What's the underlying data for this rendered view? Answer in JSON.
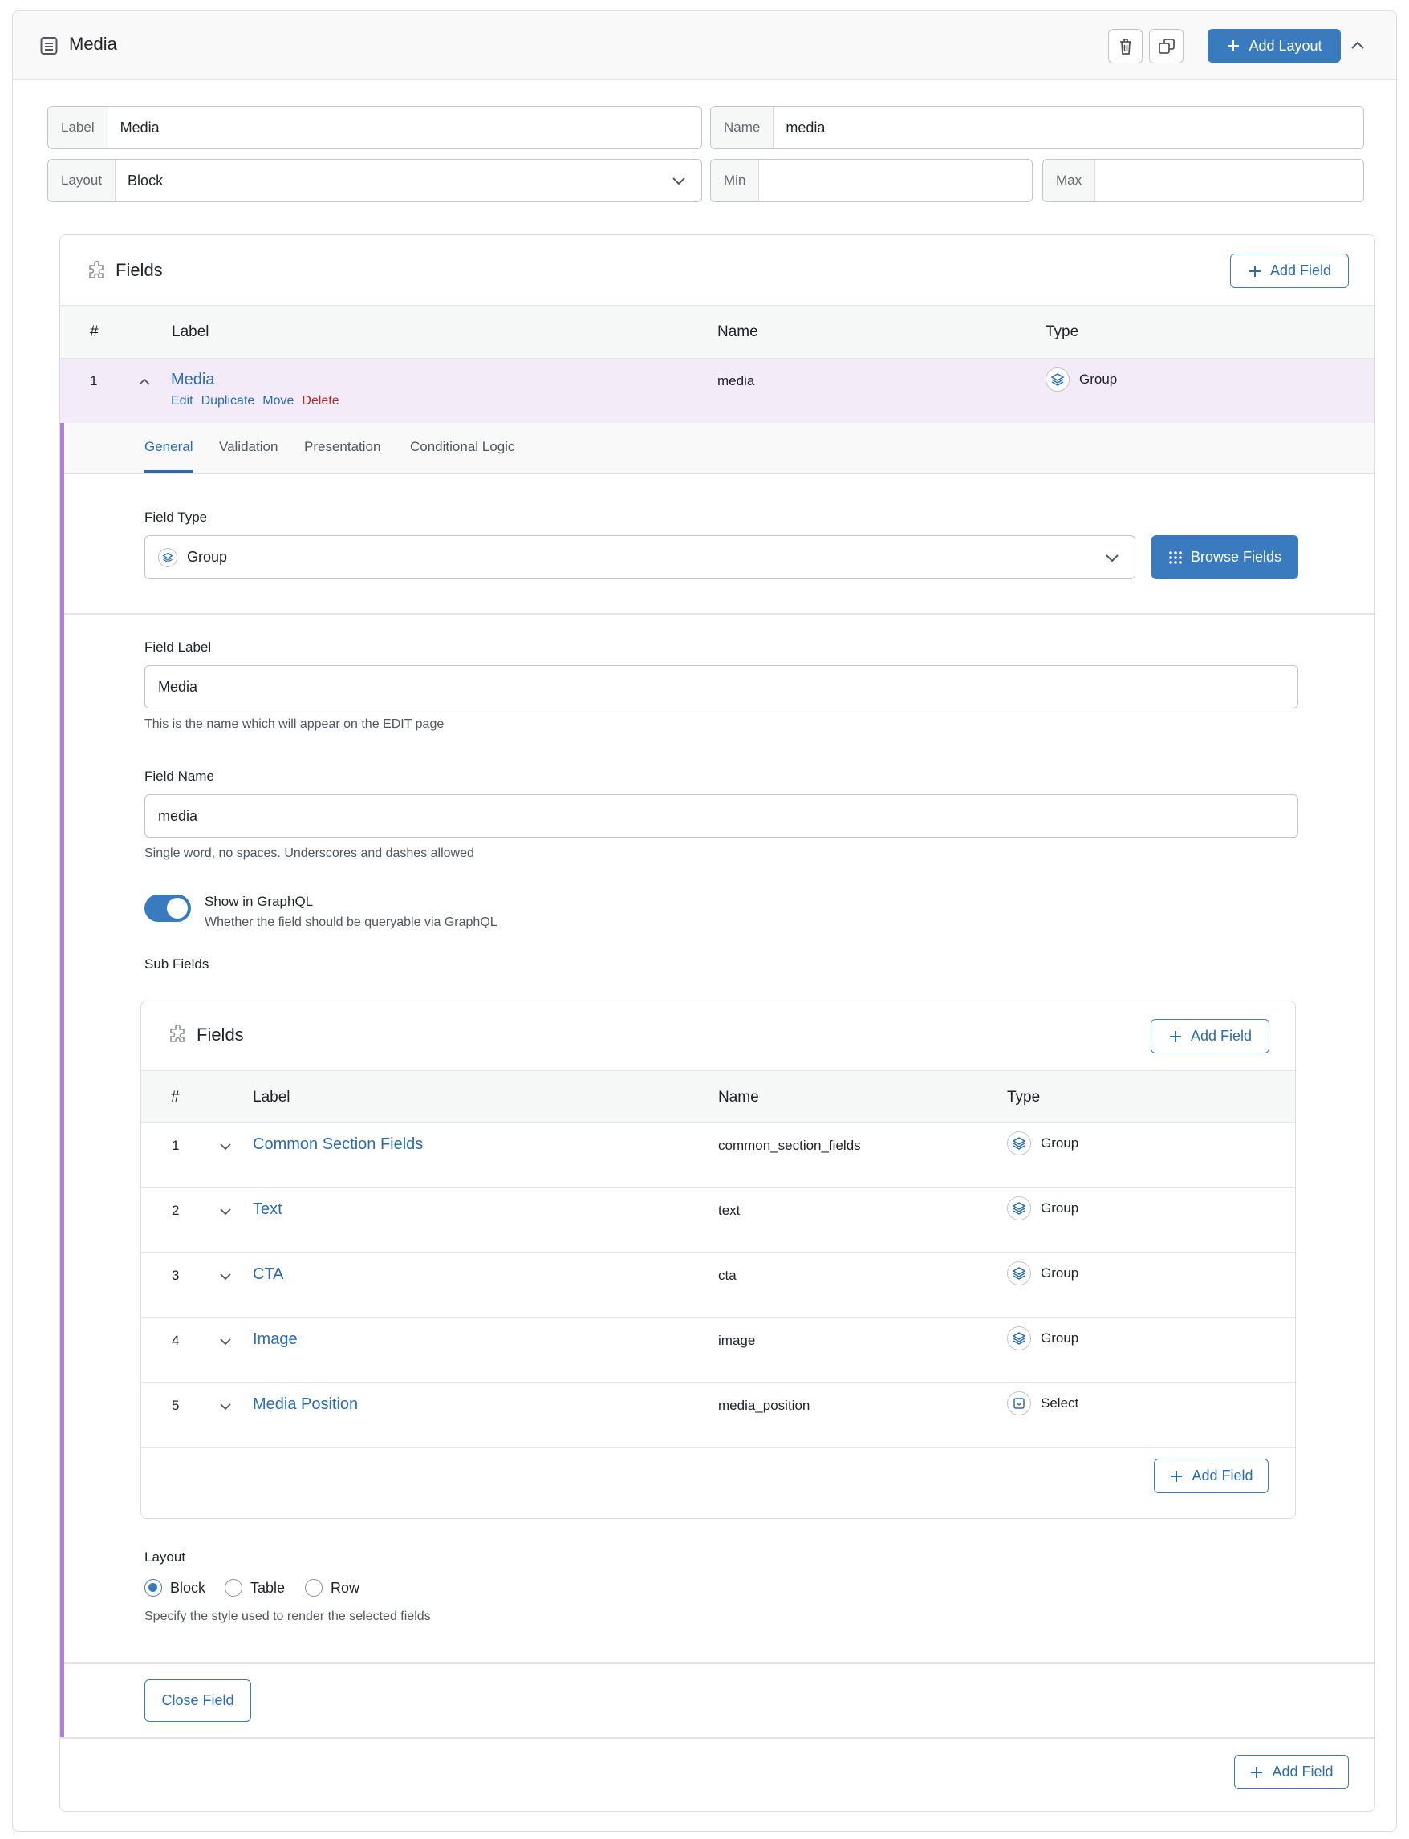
{
  "layout": {
    "title": "Media",
    "add_layout_label": "Add Layout",
    "label_prefix": "Label",
    "label_value": "Media",
    "name_prefix": "Name",
    "name_value": "media",
    "layout_prefix": "Layout",
    "layout_value": "Block",
    "min_prefix": "Min",
    "min_value": "",
    "max_prefix": "Max",
    "max_value": ""
  },
  "fields": {
    "title": "Fields",
    "add_field_label": "Add Field",
    "columns": {
      "num": "#",
      "label": "Label",
      "name": "Name",
      "type": "Type"
    },
    "row": {
      "num": "1",
      "label": "Media",
      "name": "media",
      "type": "Group",
      "actions": {
        "edit": "Edit",
        "duplicate": "Duplicate",
        "move": "Move",
        "delete": "Delete"
      }
    }
  },
  "tabs": [
    "General",
    "Validation",
    "Presentation",
    "Conditional Logic"
  ],
  "field_type": {
    "label": "Field Type",
    "value": "Group",
    "browse_label": "Browse Fields"
  },
  "field_label": {
    "label": "Field Label",
    "value": "Media",
    "hint": "This is the name which will appear on the EDIT page"
  },
  "field_name": {
    "label": "Field Name",
    "value": "media",
    "hint": "Single word, no spaces. Underscores and dashes allowed"
  },
  "graphql": {
    "label": "Show in GraphQL",
    "hint": "Whether the field should be queryable via GraphQL",
    "enabled": true
  },
  "sub_fields": {
    "label": "Sub Fields",
    "title": "Fields",
    "add_field_label": "Add Field",
    "columns": {
      "num": "#",
      "label": "Label",
      "name": "Name",
      "type": "Type"
    },
    "rows": [
      {
        "num": "1",
        "label": "Common Section Fields",
        "name": "common_section_fields",
        "type": "Group",
        "icon": "layers-icon"
      },
      {
        "num": "2",
        "label": "Text",
        "name": "text",
        "type": "Group",
        "icon": "layers-icon"
      },
      {
        "num": "3",
        "label": "CTA",
        "name": "cta",
        "type": "Group",
        "icon": "layers-icon"
      },
      {
        "num": "4",
        "label": "Image",
        "name": "image",
        "type": "Group",
        "icon": "layers-icon"
      },
      {
        "num": "5",
        "label": "Media Position",
        "name": "media_position",
        "type": "Select",
        "icon": "select-icon"
      }
    ]
  },
  "sub_layout": {
    "label": "Layout",
    "options": [
      "Block",
      "Table",
      "Row"
    ],
    "selected": "Block",
    "hint": "Specify the style used to render the selected fields"
  },
  "close_field_label": "Close Field",
  "colors": {
    "accent": "#3a7bbf",
    "active_row": "#f3ebf7",
    "active_border": "#b27ed6",
    "danger": "#b32d2e"
  }
}
